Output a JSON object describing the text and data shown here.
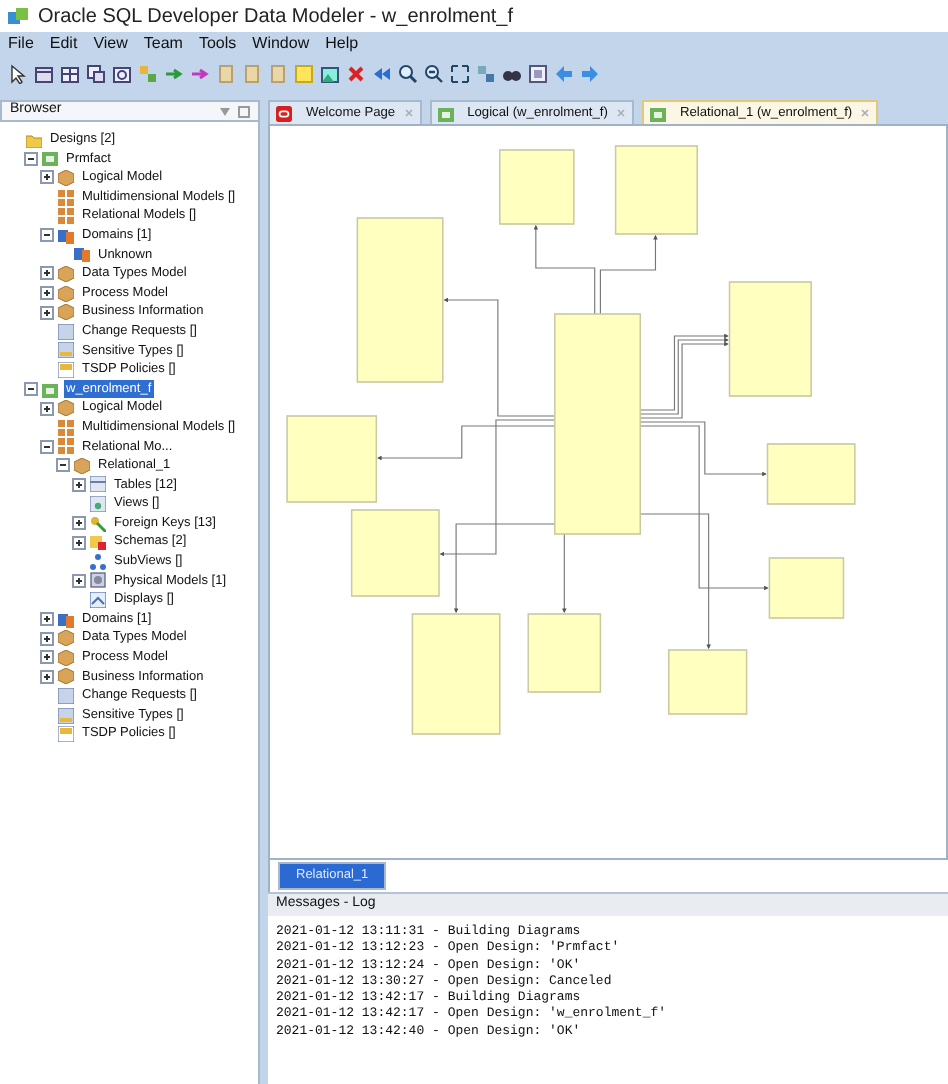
{
  "window": {
    "title": "Oracle SQL Developer Data Modeler - w_enrolment_f"
  },
  "menu": [
    "File",
    "Edit",
    "View",
    "Team",
    "Tools",
    "Window",
    "Help"
  ],
  "browser": {
    "title": "Browser",
    "tree": [
      {
        "label": "Designs [2]",
        "kind": "folder",
        "selected": false,
        "children": [
          {
            "label": "Prmfact",
            "kind": "design",
            "expanded": true,
            "selected": false,
            "children": [
              {
                "label": "Logical Model",
                "kind": "cube",
                "expanded": false,
                "selected": false
              },
              {
                "label": "Multidimensional Models []",
                "kind": "grid",
                "selected": false
              },
              {
                "label": "Relational Models []",
                "kind": "grid",
                "selected": false
              },
              {
                "label": "Domains [1]",
                "kind": "domain",
                "expanded": true,
                "selected": false,
                "children": [
                  {
                    "label": "Unknown",
                    "kind": "domain",
                    "selected": false
                  }
                ]
              },
              {
                "label": "Data Types Model",
                "kind": "cube",
                "expanded": false,
                "selected": false
              },
              {
                "label": "Process Model",
                "kind": "cube",
                "expanded": false,
                "selected": false
              },
              {
                "label": "Business Information",
                "kind": "cube",
                "expanded": false,
                "selected": false
              },
              {
                "label": "Change Requests []",
                "kind": "request",
                "selected": false
              },
              {
                "label": "Sensitive Types []",
                "kind": "sensitive",
                "selected": false
              },
              {
                "label": "TSDP Policies []",
                "kind": "policy",
                "selected": false
              }
            ]
          },
          {
            "label": "w_enrolment_f",
            "kind": "design",
            "expanded": true,
            "selected": true,
            "children": [
              {
                "label": "Logical Model",
                "kind": "cube",
                "expanded": false,
                "selected": false
              },
              {
                "label": "Multidimensional Models []",
                "kind": "grid",
                "selected": false
              },
              {
                "label": "Relational Mo...",
                "kind": "grid",
                "expanded": true,
                "selected": false,
                "children": [
                  {
                    "label": "Relational_1",
                    "kind": "cube",
                    "expanded": true,
                    "selected": false,
                    "children": [
                      {
                        "label": "Tables [12]",
                        "kind": "table",
                        "expanded": false,
                        "selected": false
                      },
                      {
                        "label": "Views []",
                        "kind": "view",
                        "selected": false
                      },
                      {
                        "label": "Foreign Keys [13]",
                        "kind": "fk",
                        "expanded": false,
                        "selected": false
                      },
                      {
                        "label": "Schemas [2]",
                        "kind": "schema",
                        "expanded": false,
                        "selected": false
                      },
                      {
                        "label": "SubViews []",
                        "kind": "subview",
                        "selected": false
                      },
                      {
                        "label": "Physical Models [1]",
                        "kind": "physical",
                        "expanded": false,
                        "selected": false
                      },
                      {
                        "label": "Displays []",
                        "kind": "display",
                        "selected": false
                      }
                    ]
                  }
                ]
              },
              {
                "label": "Domains [1]",
                "kind": "domain",
                "expanded": false,
                "selected": false
              },
              {
                "label": "Data Types Model",
                "kind": "cube",
                "expanded": false,
                "selected": false
              },
              {
                "label": "Process Model",
                "kind": "cube",
                "expanded": false,
                "selected": false
              },
              {
                "label": "Business Information",
                "kind": "cube",
                "expanded": false,
                "selected": false
              },
              {
                "label": "Change Requests []",
                "kind": "request",
                "selected": false
              },
              {
                "label": "Sensitive Types []",
                "kind": "sensitive",
                "selected": false
              },
              {
                "label": "TSDP Policies []",
                "kind": "policy",
                "selected": false
              }
            ]
          }
        ]
      }
    ]
  },
  "editor_tabs": [
    {
      "label": "Welcome Page",
      "kind": "oracle",
      "selected": false
    },
    {
      "label": "Logical (w_enrolment_f)",
      "kind": "design",
      "selected": false
    },
    {
      "label": "Relational_1 (w_enrolment_f)",
      "kind": "design",
      "selected": true
    }
  ],
  "diagram_tabs": [
    {
      "label": "Relational_1",
      "selected": true
    }
  ],
  "log": {
    "title": "Messages - Log",
    "lines": [
      "2021-01-12 13:11:31 - Building Diagrams",
      "2021-01-12 13:12:23 - Open Design: 'Prmfact'",
      "2021-01-12 13:12:24 - Open Design: 'OK'",
      "2021-01-12 13:30:27 - Open Design: Canceled",
      "2021-01-12 13:42:17 - Building Diagrams",
      "2021-01-12 13:42:17 - Open Design: 'w_enrolment_f'",
      "2021-01-12 13:42:40 - Open Design: 'OK'"
    ]
  }
}
